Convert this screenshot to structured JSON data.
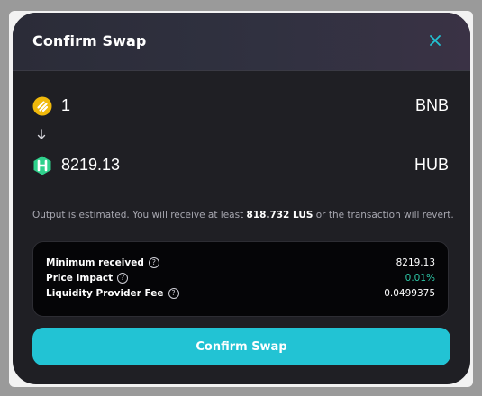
{
  "modal": {
    "title": "Confirm Swap",
    "close_icon": "close-icon"
  },
  "swap": {
    "from": {
      "amount": "1",
      "symbol": "BNB",
      "icon": "bnb-token-icon",
      "color": "#f0b90b"
    },
    "to": {
      "amount": "8219.13",
      "symbol": "HUB",
      "icon": "hub-token-icon",
      "color": "#2fd18c"
    },
    "arrow_icon": "arrow-down-icon"
  },
  "estimate": {
    "prefix": "Output is estimated. You will receive at least ",
    "min_amount": "818.732 LUS",
    "suffix": " or the transaction will revert."
  },
  "details": {
    "minimum_received": {
      "label": "Minimum received",
      "value": "8219.13"
    },
    "price_impact": {
      "label": "Price Impact",
      "value": "0.01%",
      "value_color": "#2ec9a8"
    },
    "lp_fee": {
      "label": "Liquidity Provider Fee",
      "value": "0.0499375"
    },
    "help_icon": "help-circle-icon"
  },
  "actions": {
    "confirm_label": "Confirm Swap",
    "confirm_color": "#22c3d4"
  }
}
